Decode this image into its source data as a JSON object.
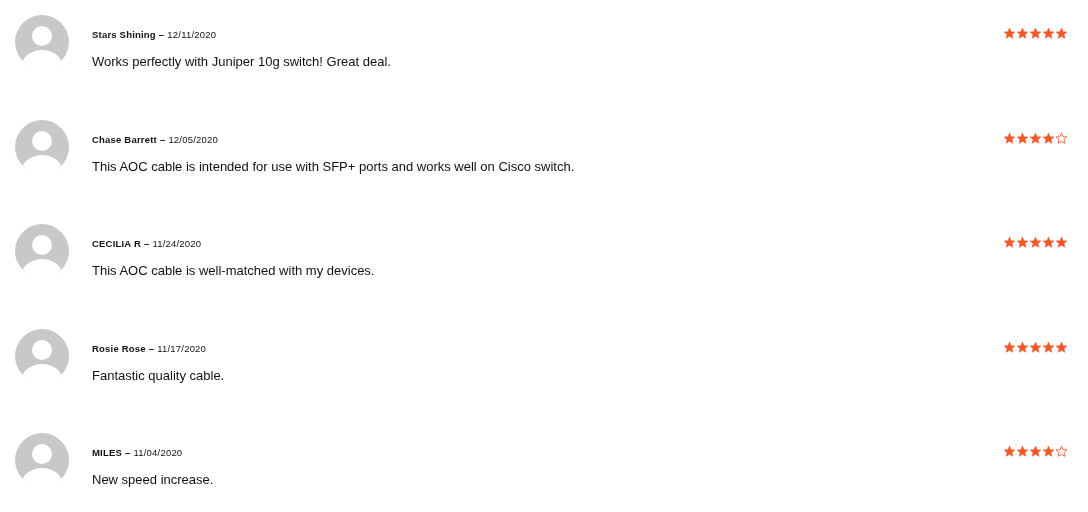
{
  "reviews": [
    {
      "author": "Stars Shining",
      "separator": "–",
      "date": "12/11/2020",
      "text": "Works perfectly with Juniper 10g switch! Great deal.",
      "stars": 5
    },
    {
      "author": "Chase Barrett",
      "separator": "–",
      "date": "12/05/2020",
      "text": "This AOC cable is intended for use with SFP+ ports and works well on Cisco switch.",
      "stars": 4
    },
    {
      "author": "CECILIA R",
      "separator": "–",
      "date": "11/24/2020",
      "text": "This AOC cable is well-matched with my devices.",
      "stars": 5
    },
    {
      "author": "Rosie Rose",
      "separator": "–",
      "date": "11/17/2020",
      "text": "Fantastic quality cable.",
      "stars": 5
    },
    {
      "author": "MILES",
      "separator": "–",
      "date": "11/04/2020",
      "text": "New speed increase.",
      "stars": 4
    }
  ]
}
